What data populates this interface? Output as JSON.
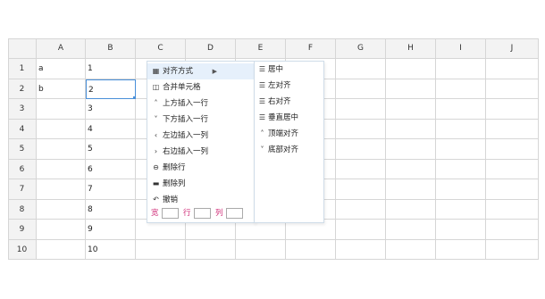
{
  "columns": [
    "A",
    "B",
    "C",
    "D",
    "E",
    "F",
    "G",
    "H",
    "I",
    "J"
  ],
  "rows": [
    "1",
    "2",
    "3",
    "4",
    "5",
    "6",
    "7",
    "8",
    "9",
    "10"
  ],
  "cells": {
    "A1": "a",
    "A2": "b",
    "B1": "1",
    "B2": "2",
    "B3": "3",
    "B4": "4",
    "B5": "5",
    "B6": "6",
    "B7": "7",
    "B8": "8",
    "B9": "9",
    "B10": "10"
  },
  "selected_cell": "B2",
  "accent_color": "#4a90d9",
  "context_menu": {
    "items": [
      {
        "icon": "align-icon",
        "label": "对齐方式",
        "has_submenu": true
      },
      {
        "icon": "merge-cells-icon",
        "label": "合并单元格"
      },
      {
        "icon": "chevron-up-icon",
        "label": "上方插入一行"
      },
      {
        "icon": "chevron-down-icon",
        "label": "下方插入一行"
      },
      {
        "icon": "chevron-left-icon",
        "label": "左边插入一列"
      },
      {
        "icon": "chevron-right-icon",
        "label": "右边插入一列"
      },
      {
        "icon": "delete-row-icon",
        "label": "删除行"
      },
      {
        "icon": "delete-column-icon",
        "label": "删除列"
      },
      {
        "icon": "undo-icon",
        "label": "撤销"
      }
    ],
    "size_labels": {
      "width": "宽",
      "row": "行",
      "column": "列"
    },
    "size_values": {
      "width": "",
      "row": "",
      "column": ""
    }
  },
  "submenu": {
    "items": [
      {
        "icon": "align-center-icon",
        "label": "居中"
      },
      {
        "icon": "align-left-icon",
        "label": "左对齐"
      },
      {
        "icon": "align-right-icon",
        "label": "右对齐"
      },
      {
        "icon": "align-vertical-center-icon",
        "label": "垂直居中"
      },
      {
        "icon": "align-top-icon",
        "label": "顶端对齐"
      },
      {
        "icon": "align-bottom-icon",
        "label": "底部对齐"
      }
    ]
  }
}
